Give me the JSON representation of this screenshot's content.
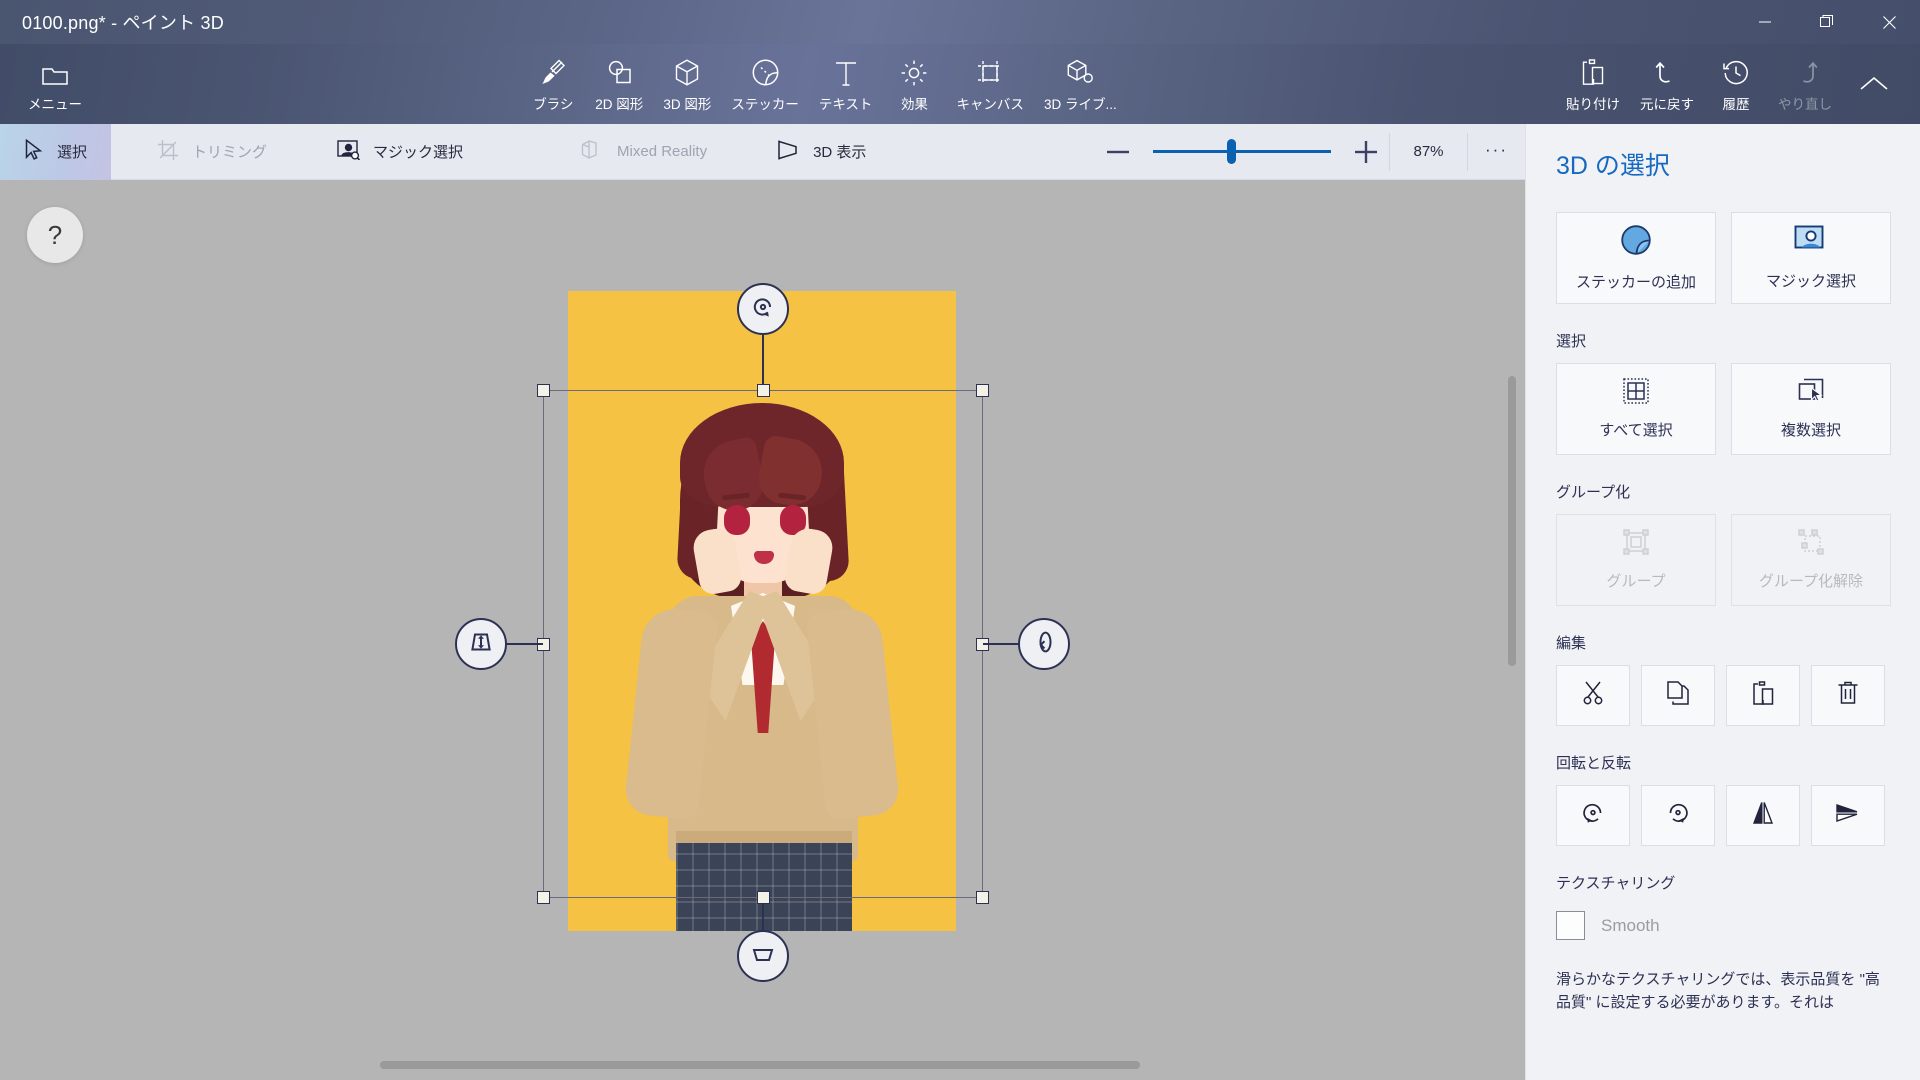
{
  "window": {
    "title": "0100.png* - ペイント 3D",
    "controls": {
      "minimize": "minimize-icon",
      "restore": "restore-icon",
      "close": "close-icon"
    }
  },
  "ribbon": {
    "items": [
      {
        "label": "メニュー",
        "icon": "folder-icon",
        "name": "menu",
        "disabled": false
      },
      {
        "label": "ブラシ",
        "icon": "brush-icon",
        "name": "brushes",
        "disabled": false
      },
      {
        "label": "2D 図形",
        "icon": "shapes-2d-icon",
        "name": "shapes-2d",
        "disabled": false
      },
      {
        "label": "3D 図形",
        "icon": "cube-icon",
        "name": "shapes-3d",
        "disabled": false
      },
      {
        "label": "ステッカー",
        "icon": "sticker-icon",
        "name": "stickers",
        "disabled": false
      },
      {
        "label": "テキスト",
        "icon": "text-icon",
        "name": "text",
        "disabled": false
      },
      {
        "label": "効果",
        "icon": "effects-sun-icon",
        "name": "effects",
        "disabled": false
      },
      {
        "label": "キャンバス",
        "icon": "canvas-icon",
        "name": "canvas",
        "disabled": false
      },
      {
        "label": "3D ライブ...",
        "icon": "3d-library-icon",
        "name": "3d-library",
        "disabled": false
      },
      {
        "label": "貼り付け",
        "icon": "paste-clipboard-icon",
        "name": "paste",
        "disabled": false
      },
      {
        "label": "元に戻す",
        "icon": "undo-icon",
        "name": "undo",
        "disabled": false
      },
      {
        "label": "履歴",
        "icon": "history-clock-icon",
        "name": "history",
        "disabled": false
      },
      {
        "label": "やり直し",
        "icon": "redo-icon",
        "name": "redo",
        "disabled": true
      }
    ],
    "collapse_icon": "chevron-up-icon"
  },
  "subbar": {
    "items": [
      {
        "label": "選択",
        "icon": "cursor-arrow-icon",
        "name": "select",
        "state": "active"
      },
      {
        "label": "トリミング",
        "icon": "crop-icon",
        "name": "crop",
        "state": "disabled"
      },
      {
        "label": "マジック選択",
        "icon": "magic-select-icon",
        "name": "magic-select",
        "state": "normal"
      },
      {
        "label": "Mixed Reality",
        "icon": "mixed-reality-icon",
        "name": "mixed-reality",
        "state": "disabled"
      },
      {
        "label": "3D 表示",
        "icon": "3d-view-icon",
        "name": "3d-view",
        "state": "normal"
      }
    ],
    "zoom": {
      "minus": "−",
      "plus": "+",
      "percent": "87%",
      "more": "···",
      "minus_icon": "zoom-out-icon",
      "plus_icon": "zoom-in-icon"
    }
  },
  "canvas": {
    "help_label": "?",
    "gizmos": [
      {
        "name": "rotate-z-gizmo",
        "icon": "rotate-z-icon",
        "position": "top"
      },
      {
        "name": "rotate-x-gizmo",
        "icon": "rotate-x-icon",
        "position": "left"
      },
      {
        "name": "rotate-y-gizmo",
        "icon": "rotate-y-icon",
        "position": "right"
      }
    ]
  },
  "panel": {
    "title": "3D の選択",
    "top_buttons": [
      {
        "label": "ステッカーの追加",
        "icon": "add-sticker-icon",
        "name": "add-sticker",
        "disabled": false
      },
      {
        "label": "マジック選択",
        "icon": "magic-select-icon",
        "name": "magic-select",
        "disabled": false
      }
    ],
    "sections": [
      {
        "title": "選択",
        "name": "selection",
        "buttons": [
          {
            "label": "すべて選択",
            "icon": "select-all-icon",
            "name": "select-all",
            "disabled": false
          },
          {
            "label": "複数選択",
            "icon": "multi-select-icon",
            "name": "multi-select",
            "disabled": false
          }
        ]
      },
      {
        "title": "グループ化",
        "name": "grouping",
        "buttons": [
          {
            "label": "グループ",
            "icon": "group-icon",
            "name": "group",
            "disabled": true
          },
          {
            "label": "グループ化解除",
            "icon": "ungroup-icon",
            "name": "ungroup",
            "disabled": true
          }
        ]
      }
    ],
    "edit": {
      "title": "編集",
      "buttons": [
        {
          "icon": "scissors-cut-icon",
          "name": "cut"
        },
        {
          "icon": "copy-icon",
          "name": "copy"
        },
        {
          "icon": "paste-icon",
          "name": "paste"
        },
        {
          "icon": "trash-delete-icon",
          "name": "delete"
        }
      ]
    },
    "rotate_flip": {
      "title": "回転と反転",
      "buttons": [
        {
          "icon": "rotate-left-icon",
          "name": "rotate-left"
        },
        {
          "icon": "rotate-right-icon",
          "name": "rotate-right"
        },
        {
          "icon": "flip-horizontal-icon",
          "name": "flip-horizontal"
        },
        {
          "icon": "flip-vertical-icon",
          "name": "flip-vertical"
        }
      ]
    },
    "texturing": {
      "title": "テクスチャリング",
      "checkbox_label": "Smooth",
      "checked": false,
      "note": "滑らかなテクスチャリングでは、表示品質を \"高品質\" に設定する必要があります。それは"
    }
  },
  "colors": {
    "accent": "#0b61b0",
    "panel_title": "#1669c1",
    "titlebar": "#4f5a77",
    "canvas_bg": "#b5b5b5",
    "artboard_bg": "#f5c243",
    "panel_bg": "#f1f2f5"
  }
}
